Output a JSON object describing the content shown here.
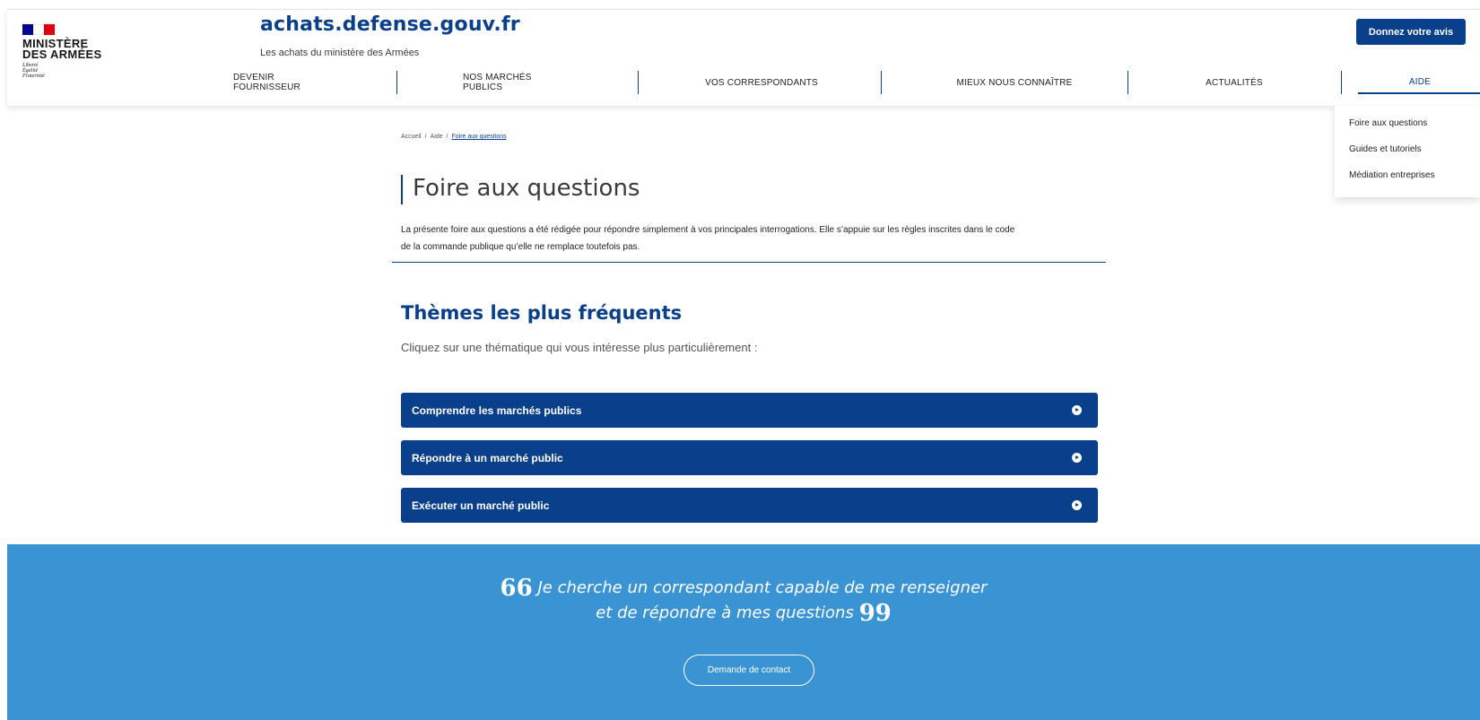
{
  "logo": {
    "flag_colors": [
      "#000091",
      "#ffffff",
      "#e1000f"
    ],
    "name": "MINISTÈRE\nDES ARMÉES",
    "motto": "Liberté\nÉgalité\nFraternité"
  },
  "header": {
    "site_title": "achats.defense.gouv.fr",
    "tagline": "Les achats du ministère des Armées",
    "feedback_button": "Donnez votre avis"
  },
  "nav": [
    {
      "label": "DEVENIR FOURNISSEUR",
      "active": false
    },
    {
      "label": "NOS MARCHÉS PUBLICS",
      "active": false
    },
    {
      "label": "VOS CORRESPONDANTS",
      "active": false
    },
    {
      "label": "MIEUX NOUS CONNAÎTRE",
      "active": false
    },
    {
      "label": "ACTUALITÉS",
      "active": false
    },
    {
      "label": "AIDE",
      "active": true
    }
  ],
  "dropdown": [
    "Foire aux questions",
    "Guides et tutoriels",
    "Médiation entreprises"
  ],
  "breadcrumb": {
    "home": "Accueil",
    "section": "Aide",
    "current": "Foire aux questions",
    "separator": "/"
  },
  "main": {
    "title": "Foire aux questions",
    "intro_line1": "La présente foire aux questions a été rédigée pour répondre simplement à vos principales interrogations. Elle s’appuie sur les règles inscrites dans le code",
    "intro_line2": "de la commande publique qu’elle ne remplace toutefois pas.",
    "themes_title": "Thèmes les plus fréquents",
    "themes_subtitle": "Cliquez sur une thématique qui vous intéresse plus particulièrement :",
    "themes": [
      "Comprendre les marchés publics",
      "Répondre à un marché public",
      "Exécuter un marché public"
    ]
  },
  "band": {
    "open_quote": "66",
    "quote_line1": "Je cherche un correspondant capable de me renseigner",
    "quote_line2": "et de répondre à mes questions",
    "close_quote": "99",
    "contact_button": "Demande de contact"
  },
  "colors": {
    "primary": "#0a3f8c",
    "band": "#3a93d3"
  }
}
